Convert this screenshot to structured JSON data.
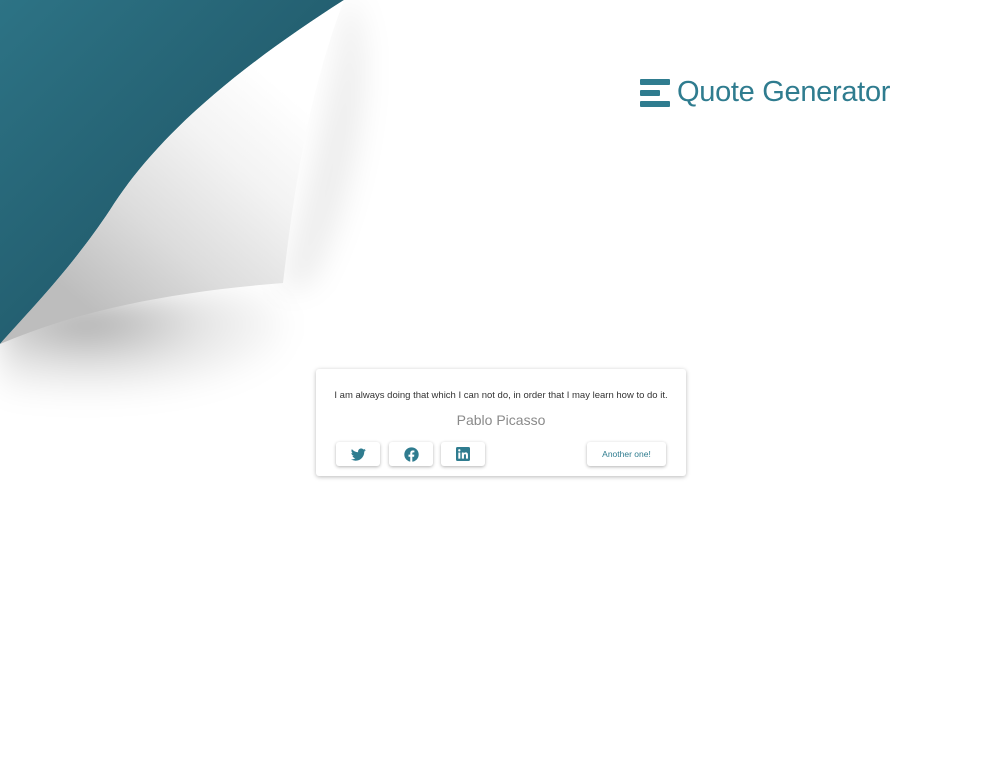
{
  "header": {
    "logo_icon": "bars-icon",
    "title": "Quote Generator"
  },
  "quote": {
    "text": "I am always doing that which I can not do, in order that I may learn how to do it.",
    "author": "Pablo Picasso"
  },
  "actions": {
    "share_buttons": [
      {
        "icon": "twitter-icon"
      },
      {
        "icon": "facebook-icon"
      },
      {
        "icon": "linkedin-icon"
      }
    ],
    "next_label": "Another one!"
  },
  "colors": {
    "accent": "#2f7c8f",
    "page_curl_dark": "#1e5261",
    "background": "#ffffff"
  }
}
